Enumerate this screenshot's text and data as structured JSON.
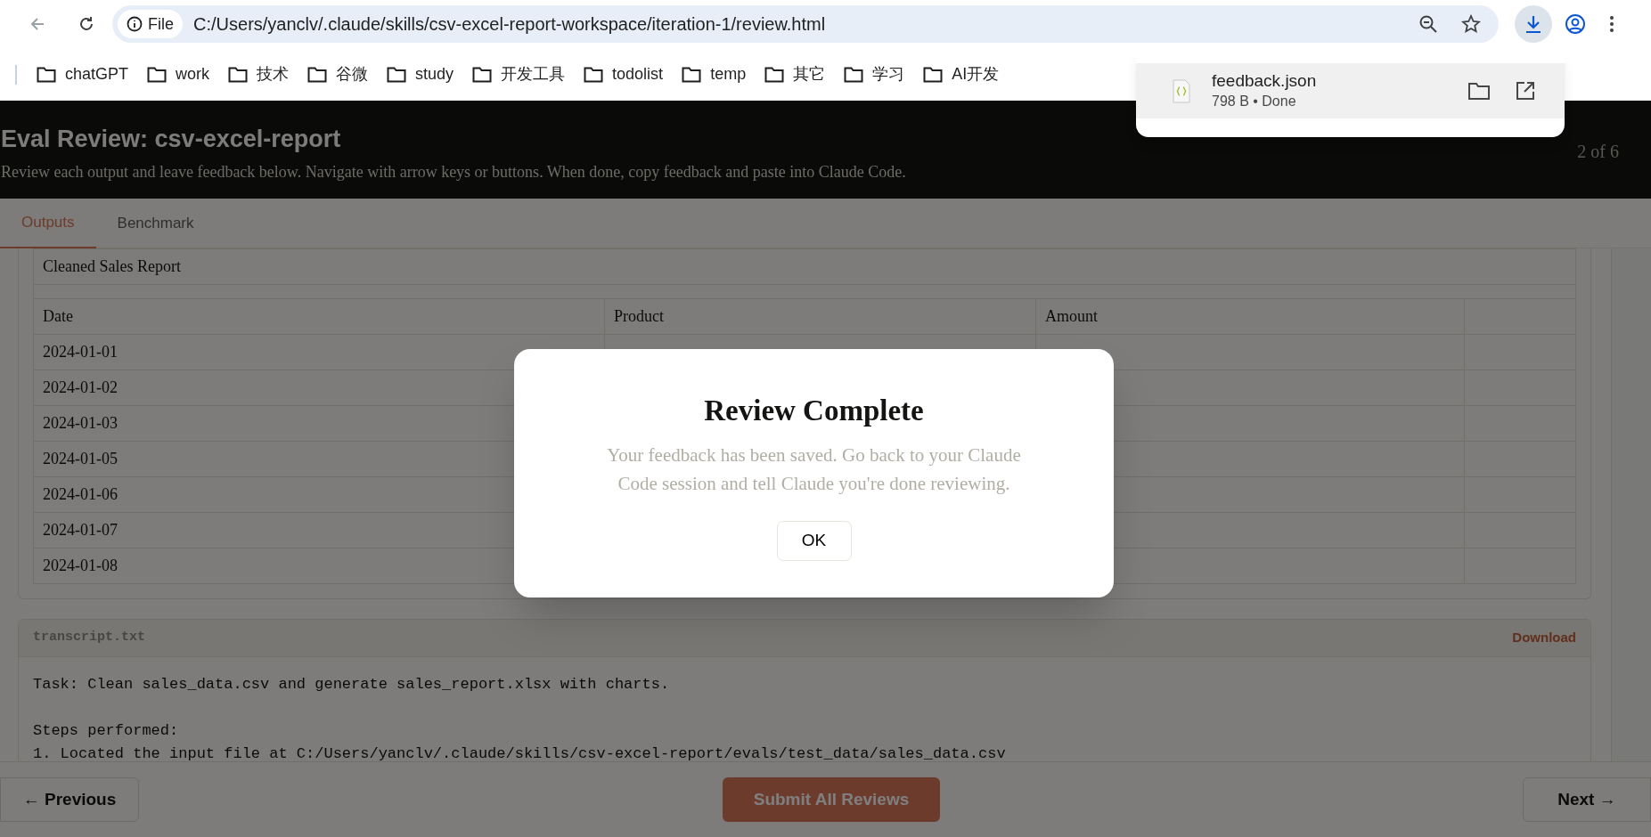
{
  "browser": {
    "address": {
      "scheme_chip": "File",
      "url": "C:/Users/yanclv/.claude/skills/csv-excel-report-workspace/iteration-1/review.html"
    },
    "bookmarks": [
      "chatGPT",
      "work",
      "技术",
      "谷微",
      "study",
      "开发工具",
      "todolist",
      "temp",
      "其它",
      "学习",
      "AI开发"
    ],
    "download_popup": {
      "file_name": "feedback.json",
      "status": "798 B • Done"
    }
  },
  "page": {
    "header": {
      "title": "Eval Review: csv-excel-report",
      "subtitle": "Review each output and leave feedback below. Navigate with arrow keys or buttons. When done, copy feedback and paste into Claude Code.",
      "counter": "2 of 6"
    },
    "tabs": [
      {
        "label": "Outputs",
        "selected": true
      },
      {
        "label": "Benchmark",
        "selected": false
      }
    ],
    "table": {
      "caption": "Cleaned Sales Report",
      "columns": [
        "Date",
        "Product",
        "Amount"
      ],
      "rows": [
        {
          "date": "2024-01-01"
        },
        {
          "date": "2024-01-02"
        },
        {
          "date": "2024-01-03"
        },
        {
          "date": "2024-01-05"
        },
        {
          "date": "2024-01-06"
        },
        {
          "date": "2024-01-07"
        },
        {
          "date": "2024-01-08"
        }
      ]
    },
    "transcript": {
      "file_name": "transcript.txt",
      "download_link": "Download",
      "lines": [
        "Task: Clean sales_data.csv and generate sales_report.xlsx with charts.",
        "Steps performed:",
        "1. Located the input file at C:/Users/yanclv/.claude/skills/csv-excel-report/evals/test_data/sales_data.csv"
      ]
    },
    "footer": {
      "previous": "← Previous",
      "submit": "Submit All Reviews",
      "next": "Next →"
    }
  },
  "modal": {
    "title": "Review Complete",
    "message": "Your feedback has been saved. Go back to your Claude Code session and tell Claude you're done reviewing.",
    "button": "OK"
  }
}
